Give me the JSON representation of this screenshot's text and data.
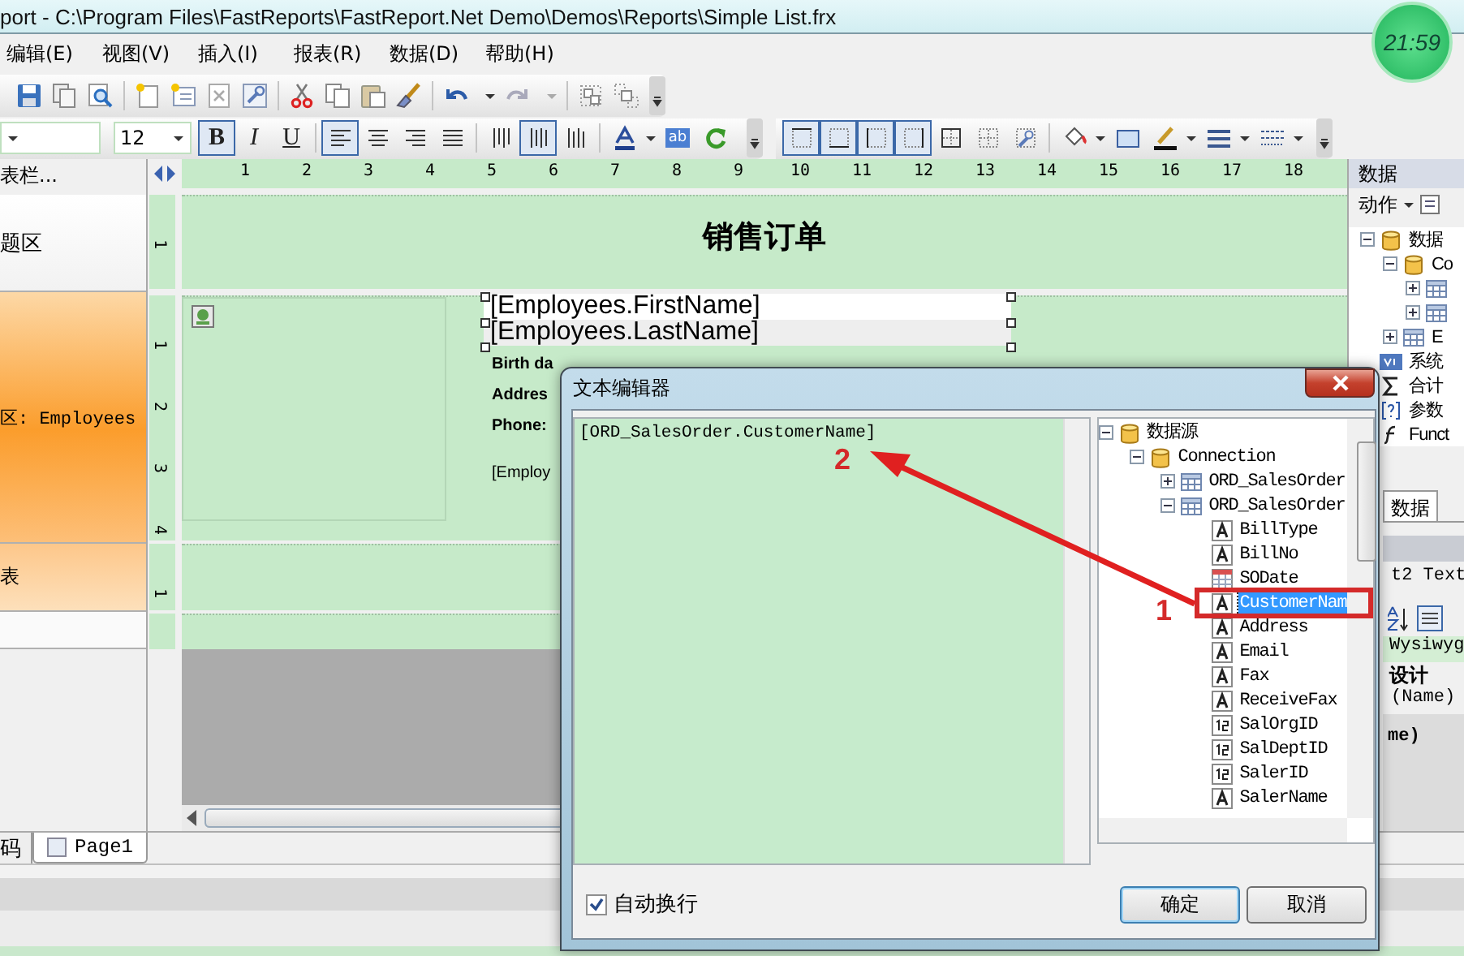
{
  "window": {
    "title": "port - C:\\Program Files\\FastReports\\FastReport.Net Demo\\Demos\\Reports\\Simple List.frx"
  },
  "clock": {
    "time": "21:59"
  },
  "menu": [
    "编辑(E)",
    "视图(V)",
    "插入(I)",
    "报表(R)",
    "数据(D)",
    "帮助(H)"
  ],
  "format_toolbar": {
    "font_size": "12",
    "groups": [
      {
        "buttons": [
          {
            "kind": "bold",
            "label": "B",
            "selected": true
          },
          {
            "kind": "italic",
            "label": "I",
            "selected": false
          },
          {
            "kind": "underline",
            "label": "U",
            "selected": false
          }
        ]
      },
      {
        "buttons": [
          {
            "kind": "align-left",
            "selected": true
          },
          {
            "kind": "align-center",
            "selected": false
          },
          {
            "kind": "align-right",
            "selected": false
          },
          {
            "kind": "justify",
            "selected": false
          }
        ]
      },
      {
        "buttons": [
          {
            "kind": "valign-top",
            "selected": false
          },
          {
            "kind": "valign-middle",
            "selected": true
          },
          {
            "kind": "valign-bottom",
            "selected": false
          }
        ]
      },
      {
        "buttons": [
          {
            "kind": "font-color",
            "selected": false,
            "menu": true
          },
          {
            "kind": "highlight",
            "label": "ab",
            "selected": false
          },
          {
            "kind": "rotate",
            "selected": false
          }
        ]
      }
    ]
  },
  "border_toolbar": {
    "groups": [
      {
        "buttons": [
          {
            "kind": "border-top",
            "selected": true
          },
          {
            "kind": "border-bottom",
            "selected": true
          },
          {
            "kind": "border-left",
            "selected": true
          },
          {
            "kind": "border-right",
            "selected": true
          },
          {
            "kind": "border-all",
            "selected": false
          },
          {
            "kind": "border-none",
            "selected": false
          },
          {
            "kind": "border-style",
            "selected": false
          }
        ]
      },
      {
        "buttons": [
          {
            "kind": "fill-color",
            "selected": false,
            "menu": true
          },
          {
            "kind": "frame",
            "selected": false
          },
          {
            "kind": "line-color",
            "selected": false,
            "menu": true
          },
          {
            "kind": "line-width",
            "selected": false,
            "menu": true
          },
          {
            "kind": "line-style",
            "selected": false,
            "menu": true
          }
        ]
      }
    ]
  },
  "report_tree": {
    "header": "表栏...",
    "bands": [
      {
        "label": "题区",
        "kind": "plain"
      },
      {
        "label": "区: Employees",
        "kind": "data"
      },
      {
        "label": "表",
        "kind": "child"
      }
    ]
  },
  "ruler": {
    "horizontal": [
      "1",
      "2",
      "3",
      "4",
      "5",
      "6",
      "7",
      "8",
      "9",
      "10",
      "11",
      "12",
      "13",
      "14",
      "15",
      "16",
      "17",
      "18"
    ],
    "vertical": [
      [
        "1"
      ],
      [
        "1",
        "2",
        "3",
        "4"
      ],
      [
        "1"
      ]
    ]
  },
  "report": {
    "title": "销售订单",
    "fields": [
      "[Employees.FirstName]",
      "[Employees.LastName]"
    ],
    "labels": [
      "Birth da",
      "Addres",
      "Phone:",
      "[Employ"
    ]
  },
  "page_tabs": [
    {
      "label": "码",
      "selected": false
    },
    {
      "label": "Page1",
      "selected": true
    }
  ],
  "data_panel": {
    "title": "数据",
    "actions": "动作",
    "tree": [
      {
        "label": "数据",
        "kind": "database",
        "expanded": true,
        "children": [
          {
            "label": "Co",
            "kind": "database",
            "expanded": true,
            "children": [
              {
                "kind": "table",
                "expanded": false
              },
              {
                "kind": "table",
                "expanded": false
              }
            ]
          },
          {
            "label": "E",
            "kind": "table",
            "expanded": false
          }
        ]
      },
      {
        "label": "系统",
        "kind": "variables"
      },
      {
        "label": "合计",
        "kind": "total"
      },
      {
        "label": "参数",
        "kind": "parameter"
      },
      {
        "label": "Funct",
        "kind": "function"
      }
    ],
    "tabs": [
      {
        "label": "数据",
        "selected": true
      }
    ],
    "properties": {
      "object": "t2 Text",
      "mode": "Wysiwyg",
      "category": "设计",
      "rows": [
        "(Name)"
      ],
      "description": "me)"
    }
  },
  "dialog": {
    "title": "文本编辑器",
    "text": "[ORD_SalesOrder.CustomerName]",
    "word_wrap": {
      "label": "自动换行",
      "checked": true
    },
    "tree": [
      {
        "label": "数据源",
        "kind": "database",
        "expanded": true,
        "children": [
          {
            "label": "Connection",
            "kind": "database",
            "expanded": true,
            "children": [
              {
                "label": "ORD_SalesOrder",
                "kind": "table",
                "expanded": false
              },
              {
                "label": "ORD_SalesOrder",
                "kind": "table",
                "expanded": true,
                "children": [
                  {
                    "label": "BillType",
                    "kind": "text",
                    "selected": false
                  },
                  {
                    "label": "BillNo",
                    "kind": "text",
                    "selected": false
                  },
                  {
                    "label": "SODate",
                    "kind": "date",
                    "selected": false
                  },
                  {
                    "label": "CustomerNam",
                    "kind": "text",
                    "selected": true
                  },
                  {
                    "label": "Address",
                    "kind": "text",
                    "selected": false
                  },
                  {
                    "label": "Email",
                    "kind": "text",
                    "selected": false
                  },
                  {
                    "label": "Fax",
                    "kind": "text",
                    "selected": false
                  },
                  {
                    "label": "ReceiveFax",
                    "kind": "text",
                    "selected": false
                  },
                  {
                    "label": "SalOrgID",
                    "kind": "number",
                    "selected": false
                  },
                  {
                    "label": "SalDeptID",
                    "kind": "number",
                    "selected": false
                  },
                  {
                    "label": "SalerID",
                    "kind": "number",
                    "selected": false
                  },
                  {
                    "label": "SalerName",
                    "kind": "text",
                    "selected": false
                  }
                ]
              }
            ]
          }
        ]
      }
    ],
    "buttons": [
      "确定",
      "取消"
    ]
  },
  "annotations": [
    {
      "label": "1"
    },
    {
      "label": "2"
    }
  ]
}
